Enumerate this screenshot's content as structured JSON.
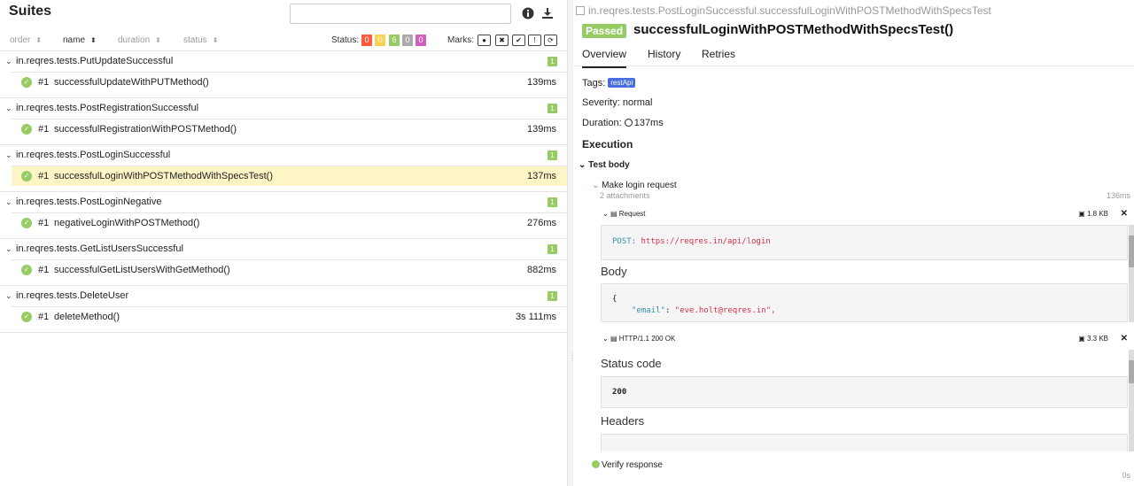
{
  "left": {
    "title": "Suites",
    "sort": [
      {
        "label": "order",
        "active": false
      },
      {
        "label": "name",
        "active": true
      },
      {
        "label": "duration",
        "active": false
      },
      {
        "label": "status",
        "active": false
      }
    ],
    "status_label": "Status:",
    "status_counts": [
      {
        "value": "0",
        "color": "#fd5a3e"
      },
      {
        "value": "0",
        "color": "#ffd050"
      },
      {
        "value": "6",
        "color": "#97cc64"
      },
      {
        "value": "0",
        "color": "#aaaaaa"
      },
      {
        "value": "0",
        "color": "#d35ebe"
      }
    ],
    "marks_label": "Marks:",
    "marks": [
      "flaky-icon",
      "new-failed-icon",
      "new-passed-icon",
      "new-broken-icon",
      "retries-icon"
    ],
    "groups": [
      {
        "name": "in.reqres.tests.PutUpdateSuccessful",
        "count": "1",
        "tests": [
          {
            "num": "#1",
            "name": "successfulUpdateWithPUTMethod()",
            "duration": "139ms",
            "selected": false
          }
        ]
      },
      {
        "name": "in.reqres.tests.PostRegistrationSuccessful",
        "count": "1",
        "tests": [
          {
            "num": "#1",
            "name": "successfulRegistrationWithPOSTMethod()",
            "duration": "139ms",
            "selected": false
          }
        ]
      },
      {
        "name": "in.reqres.tests.PostLoginSuccessful",
        "count": "1",
        "tests": [
          {
            "num": "#1",
            "name": "successfulLoginWithPOSTMethodWithSpecsTest()",
            "duration": "137ms",
            "selected": true
          }
        ]
      },
      {
        "name": "in.reqres.tests.PostLoginNegative",
        "count": "1",
        "tests": [
          {
            "num": "#1",
            "name": "negativeLoginWithPOSTMethod()",
            "duration": "276ms",
            "selected": false
          }
        ]
      },
      {
        "name": "in.reqres.tests.GetListUsersSuccessful",
        "count": "1",
        "tests": [
          {
            "num": "#1",
            "name": "successfulGetListUsersWithGetMethod()",
            "duration": "882ms",
            "selected": false
          }
        ]
      },
      {
        "name": "in.reqres.tests.DeleteUser",
        "count": "1",
        "tests": [
          {
            "num": "#1",
            "name": "deleteMethod()",
            "duration": "3s 111ms",
            "selected": false
          }
        ]
      }
    ]
  },
  "right": {
    "breadcrumb": "in.reqres.tests.PostLoginSuccessful.successfulLoginWithPOSTMethodWithSpecsTest",
    "status": "Passed",
    "test_title": "successfulLoginWithPOSTMethodWithSpecsTest()",
    "tabs": [
      "Overview",
      "History",
      "Retries"
    ],
    "tags_label": "Tags:",
    "tag": "restApi",
    "severity": "Severity: normal",
    "duration_label": "Duration:",
    "duration": "137ms",
    "execution": "Execution",
    "test_body": "Test body",
    "step_name": "Make login request",
    "attachments": "2 attachments",
    "step_duration": "136ms",
    "request": {
      "name": "Request",
      "size": "1.8 KB",
      "method": "POST:",
      "url": "https://reqres.in/api/login",
      "body_title": "Body",
      "body_line1": "{",
      "body_key": "\"email\"",
      "body_val": "\"eve.holt@reqres.in\","
    },
    "response": {
      "name": "HTTP/1.1 200 OK",
      "size": "3.3 KB",
      "status_title": "Status code",
      "status_code": "200",
      "headers_title": "Headers"
    },
    "verify": "Verify response",
    "verify_duration": "0s"
  }
}
